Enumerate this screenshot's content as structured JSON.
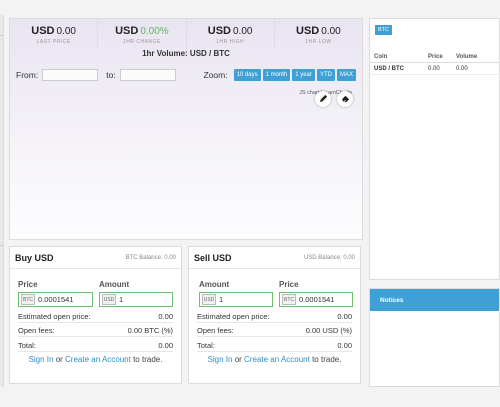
{
  "stats": [
    {
      "currency": "USD",
      "value": "0.00",
      "label": "LAST PRICE",
      "green": false
    },
    {
      "currency": "USD",
      "value": "0.00%",
      "label": "1HR CHANGE",
      "green": true
    },
    {
      "currency": "USD",
      "value": "0.00",
      "label": "1HR HIGH",
      "green": false
    },
    {
      "currency": "USD",
      "value": "0.00",
      "label": "1HR LOW",
      "green": false
    }
  ],
  "chart": {
    "title": "1hr Volume: USD / BTC",
    "from_label": "From:",
    "to_label": "to:",
    "from_value": "",
    "to_value": "",
    "zoom_label": "Zoom:",
    "zoom_options": [
      "10 days",
      "1 month",
      "1 year",
      "YTD",
      "MAX"
    ],
    "credit": "JS chart by amCharts"
  },
  "market": {
    "tab": "BTC",
    "headers": [
      "Coin",
      "Price",
      "Volume"
    ],
    "rows": [
      {
        "coin": "USD / BTC",
        "price": "0.00",
        "volume": "0.00"
      }
    ]
  },
  "notices": {
    "title": "Notices"
  },
  "buy": {
    "title": "Buy USD",
    "balance": "BTC Balance: 0.00",
    "price_label": "Price",
    "price_prefix": "BTC",
    "price_value": "0.0001541",
    "amount_label": "Amount",
    "amount_prefix": "USD",
    "amount_value": "1",
    "est_label": "Estimated open price:",
    "est_value": "0.00",
    "fees_label": "Open fees:",
    "fees_value": "0.00 BTC (%)",
    "total_label": "Total:",
    "total_value": "0.00",
    "signin": "Sign In",
    "or": " or ",
    "create": "Create an Account",
    "suffix": " to trade."
  },
  "sell": {
    "title": "Sell USD",
    "balance": "USD Balance: 0.00",
    "amount_label": "Amount",
    "amount_prefix": "USD",
    "amount_value": "1",
    "price_label": "Price",
    "price_prefix": "BTC",
    "price_value": "0.0001541",
    "est_label": "Estimated open price:",
    "est_value": "0.00",
    "fees_label": "Open fees:",
    "fees_value": "0.00 USD (%)",
    "total_label": "Total:",
    "total_value": "0.00",
    "signin": "Sign In",
    "or": " or ",
    "create": "Create an Account",
    "suffix": " to trade."
  },
  "colors": {
    "accent": "#3fa0d6",
    "positive": "#5cb85c",
    "field_border": "#6cbf6c"
  },
  "icons": {
    "draw": "pencil-icon",
    "erase": "eraser-icon"
  }
}
